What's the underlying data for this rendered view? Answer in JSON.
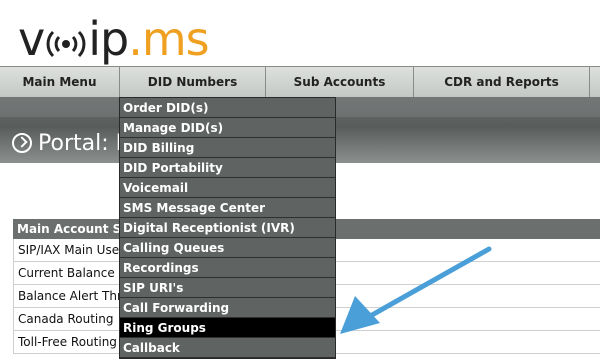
{
  "logo": {
    "part1": "v",
    "part2": "ip",
    "dot": ".",
    "part3": "ms"
  },
  "nav": {
    "items": [
      {
        "label": "Main Menu"
      },
      {
        "label": "DID Numbers"
      },
      {
        "label": "Sub Accounts"
      },
      {
        "label": "CDR and Reports"
      },
      {
        "label": ""
      }
    ]
  },
  "banner": {
    "title": "Portal: H"
  },
  "account": {
    "header": "Main Account Se",
    "rows": [
      "SIP/IAX Main Use",
      "Current Balance",
      "Balance Alert Thre",
      "Canada Routing",
      "Toll-Free Routing"
    ]
  },
  "did_menu": {
    "items": [
      "Order DID(s)",
      "Manage DID(s)",
      "DID Billing",
      "DID Portability",
      "Voicemail",
      "SMS Message Center",
      "Digital Receptionist (IVR)",
      "Calling Queues",
      "Recordings",
      "SIP URI's",
      "Call Forwarding",
      "Ring Groups",
      "Callback"
    ],
    "active_index": 11
  },
  "annotation": {
    "arrow_color": "#4a9fd8"
  },
  "colors": {
    "logo_orange": "#f0a020",
    "banner": "#5f6462",
    "menu_bg": "#5f6462",
    "menu_active": "#000000"
  }
}
